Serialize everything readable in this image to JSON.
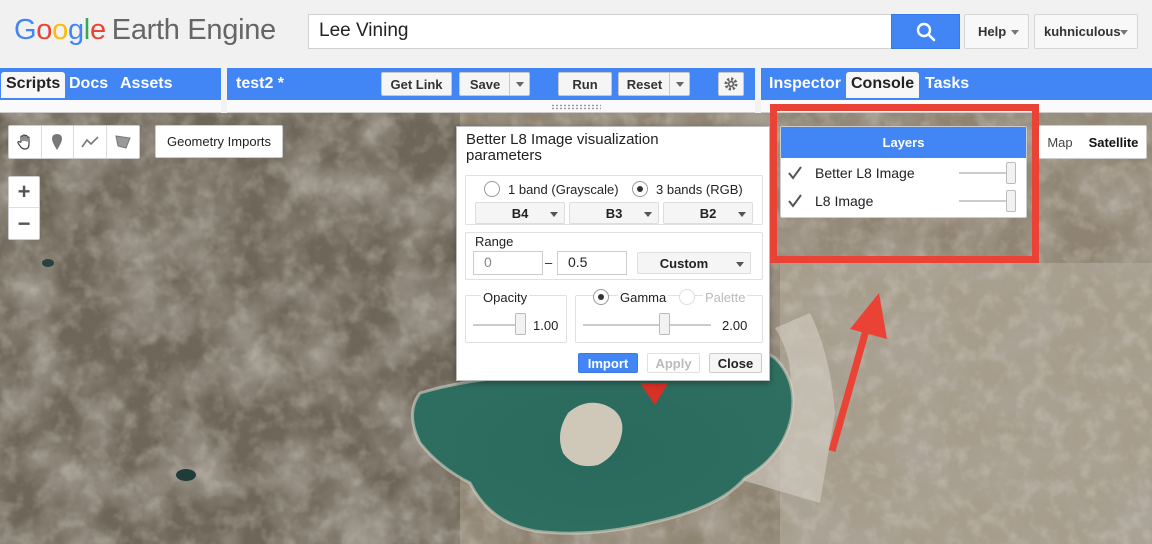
{
  "header": {
    "logo_google": [
      "G",
      "o",
      "o",
      "g",
      "l",
      "e"
    ],
    "logo_product": "Earth Engine",
    "search_value": "Lee Vining",
    "help_label": "Help",
    "user_label": "kuhniculous"
  },
  "left_panel": {
    "tabs": [
      "Scripts",
      "Docs",
      "Assets"
    ],
    "active_tab": "Scripts"
  },
  "editor": {
    "script_name": "test2 *",
    "get_link_label": "Get Link",
    "save_label": "Save",
    "run_label": "Run",
    "reset_label": "Reset"
  },
  "right_panel": {
    "tabs": [
      "Inspector",
      "Console",
      "Tasks"
    ],
    "active_tab": "Console"
  },
  "map": {
    "geometry_imports_label": "Geometry Imports",
    "zoom_in": "+",
    "zoom_out": "−",
    "map_type_map": "Map",
    "map_type_satellite": "Satellite",
    "map_type_selected": "Satellite",
    "drawing_tools": [
      "hand-icon",
      "point-icon",
      "line-icon",
      "polygon-icon"
    ]
  },
  "vis_dialog": {
    "title": "Better L8 Image visualization parameters",
    "mode_grayscale": "1 band (Grayscale)",
    "mode_rgb": "3 bands (RGB)",
    "mode_selected": "3 bands (RGB)",
    "bands": [
      "B4",
      "B3",
      "B2"
    ],
    "range_label": "Range",
    "range_min": "0",
    "range_separator": "–",
    "range_max": "0.5",
    "range_mode": "Custom",
    "opacity_label": "Opacity",
    "opacity_value": "1.00",
    "gamma_label": "Gamma",
    "palette_label": "Palette",
    "gamma_value": "2.00",
    "import_label": "Import",
    "apply_label": "Apply",
    "close_label": "Close"
  },
  "layers_panel": {
    "title": "Layers",
    "layers": [
      {
        "name": "Better L8 Image",
        "checked": true,
        "opacity": 1.0
      },
      {
        "name": "L8 Image",
        "checked": true,
        "opacity": 1.0
      }
    ]
  },
  "colors": {
    "brand_blue": "#4285f4",
    "highlight_red": "#ea4335",
    "lake": "#2d6b5e"
  }
}
